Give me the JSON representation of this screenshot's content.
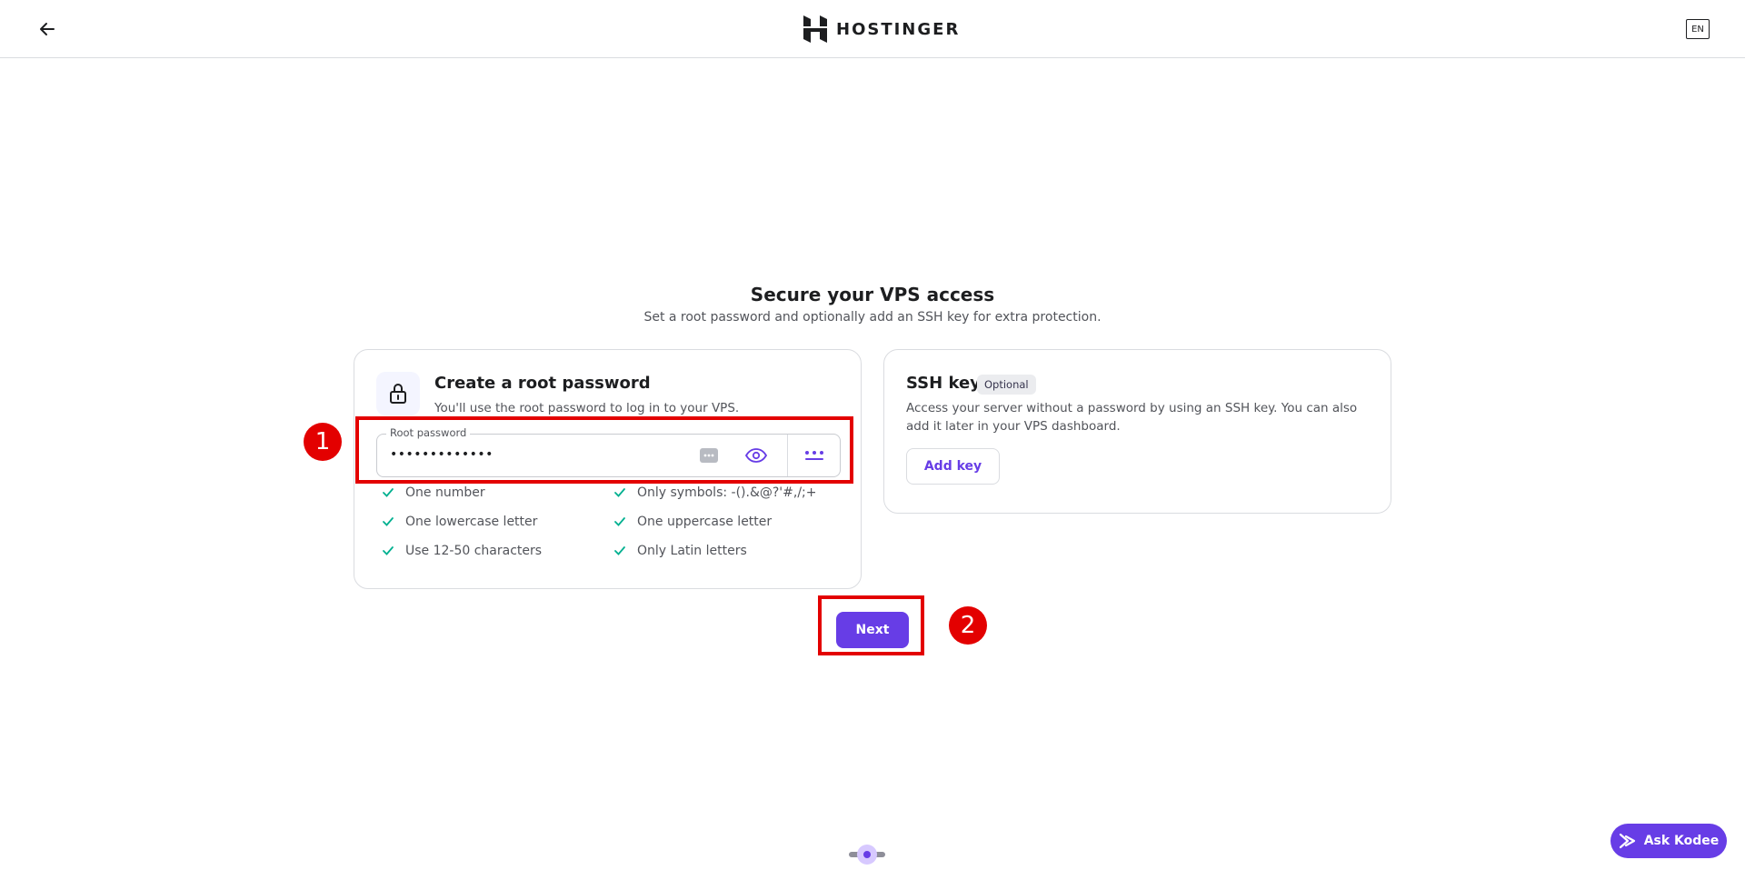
{
  "header": {
    "logo_text": "HOSTINGER",
    "language": "EN",
    "icons": {
      "back": "arrow-left-icon",
      "logo": "hostinger-logo-icon"
    }
  },
  "main": {
    "title": "Secure your VPS access",
    "subtitle": "Set a root password and optionally add an SSH key for extra protection."
  },
  "password_card": {
    "title": "Create a root password",
    "description": "You'll use the root password to log in to your VPS.",
    "field_label": "Root password",
    "field_value": "•••••••••••••",
    "icons": [
      "generate-password-icon",
      "eye-icon",
      "more-icon",
      "lock-icon"
    ],
    "rules": [
      {
        "label": "One number",
        "met": true
      },
      {
        "label": "Only symbols: -().&@?'#,/;+",
        "met": true
      },
      {
        "label": "One lowercase letter",
        "met": true
      },
      {
        "label": "One uppercase letter",
        "met": true
      },
      {
        "label": "Use 12-50 characters",
        "met": true
      },
      {
        "label": "Only Latin letters",
        "met": true
      }
    ]
  },
  "ssh_card": {
    "title": "SSH key",
    "badge": "Optional",
    "description": "Access your server without a password by using an SSH key. You can also add it later in your VPS dashboard.",
    "add_button": "Add key"
  },
  "actions": {
    "next_label": "Next"
  },
  "annotations": {
    "marker_1": "1",
    "marker_2": "2"
  },
  "assistant": {
    "label": "Ask Kodee"
  },
  "colors": {
    "accent": "#673de6",
    "check": "#00b090",
    "annotation": "#e30000",
    "text": "#1d1e20",
    "muted": "#52545a"
  }
}
